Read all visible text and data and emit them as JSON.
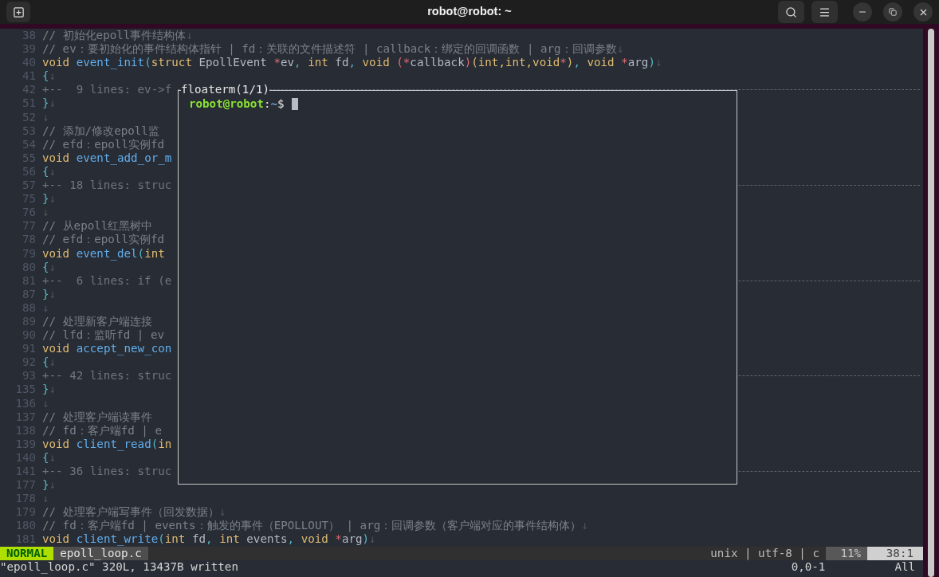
{
  "window": {
    "title": "robot@robot: ~"
  },
  "editor": {
    "lines": [
      {
        "number": "38",
        "kind": "code",
        "tokens": [
          {
            "kind": "comment",
            "text": "// 初始化epoll事件结构体"
          },
          {
            "kind": "eol",
            "text": "↓"
          }
        ]
      },
      {
        "number": "39",
        "kind": "code",
        "tokens": [
          {
            "kind": "comment",
            "text": "// ev：要初始化的事件结构体指针 | fd：关联的文件描述符 | callback：绑定的回调函数 | arg：回调参数"
          },
          {
            "kind": "eol",
            "text": "↓"
          }
        ]
      },
      {
        "number": "40",
        "kind": "code",
        "tokens": [
          {
            "kind": "keyword",
            "text": "void "
          },
          {
            "kind": "function",
            "text": "event_init"
          },
          {
            "kind": "punct",
            "text": "("
          },
          {
            "kind": "keyword",
            "text": "struct "
          },
          {
            "kind": "text",
            "text": "EpollEvent "
          },
          {
            "kind": "op",
            "text": "*"
          },
          {
            "kind": "text",
            "text": "ev"
          },
          {
            "kind": "punct",
            "text": ", "
          },
          {
            "kind": "keyword",
            "text": "int "
          },
          {
            "kind": "text",
            "text": "fd"
          },
          {
            "kind": "punct",
            "text": ", "
          },
          {
            "kind": "keyword",
            "text": "void "
          },
          {
            "kind": "op",
            "text": "(*"
          },
          {
            "kind": "text",
            "text": "callback"
          },
          {
            "kind": "op",
            "text": ")"
          },
          {
            "kind": "keyword",
            "text": "(int,int,void"
          },
          {
            "kind": "op",
            "text": "*"
          },
          {
            "kind": "keyword",
            "text": ")"
          },
          {
            "kind": "punct",
            "text": ", "
          },
          {
            "kind": "keyword",
            "text": "void "
          },
          {
            "kind": "op",
            "text": "*"
          },
          {
            "kind": "text",
            "text": "arg"
          },
          {
            "kind": "punct",
            "text": ")"
          },
          {
            "kind": "eol",
            "text": "↓"
          }
        ]
      },
      {
        "number": "41",
        "kind": "code",
        "tokens": [
          {
            "kind": "punct",
            "text": "{"
          },
          {
            "kind": "eol",
            "text": "↓"
          }
        ]
      },
      {
        "number": "42",
        "kind": "fold",
        "tokens": [
          {
            "kind": "fold",
            "text": "+--  9 lines: ev->f"
          }
        ]
      },
      {
        "number": "51",
        "kind": "code",
        "tokens": [
          {
            "kind": "punct",
            "text": "}"
          },
          {
            "kind": "eol",
            "text": "↓"
          }
        ]
      },
      {
        "number": "52",
        "kind": "code",
        "tokens": [
          {
            "kind": "eol",
            "text": "↓"
          }
        ]
      },
      {
        "number": "53",
        "kind": "code",
        "tokens": [
          {
            "kind": "comment",
            "text": "// 添加/修改epoll监"
          }
        ]
      },
      {
        "number": "54",
        "kind": "code",
        "tokens": [
          {
            "kind": "comment",
            "text": "// efd：epoll实例fd"
          }
        ]
      },
      {
        "number": "55",
        "kind": "code",
        "tokens": [
          {
            "kind": "keyword",
            "text": "void "
          },
          {
            "kind": "function",
            "text": "event_add_or_m"
          }
        ]
      },
      {
        "number": "56",
        "kind": "code",
        "tokens": [
          {
            "kind": "punct",
            "text": "{"
          },
          {
            "kind": "eol",
            "text": "↓"
          }
        ]
      },
      {
        "number": "57",
        "kind": "fold",
        "tokens": [
          {
            "kind": "fold",
            "text": "+-- 18 lines: struc"
          }
        ]
      },
      {
        "number": "75",
        "kind": "code",
        "tokens": [
          {
            "kind": "punct",
            "text": "}"
          },
          {
            "kind": "eol",
            "text": "↓"
          }
        ]
      },
      {
        "number": "76",
        "kind": "code",
        "tokens": [
          {
            "kind": "eol",
            "text": "↓"
          }
        ]
      },
      {
        "number": "77",
        "kind": "code",
        "tokens": [
          {
            "kind": "comment",
            "text": "// 从epoll红黑树中"
          }
        ]
      },
      {
        "number": "78",
        "kind": "code",
        "tokens": [
          {
            "kind": "comment",
            "text": "// efd：epoll实例fd"
          }
        ]
      },
      {
        "number": "79",
        "kind": "code",
        "tokens": [
          {
            "kind": "keyword",
            "text": "void "
          },
          {
            "kind": "function",
            "text": "event_del"
          },
          {
            "kind": "punct",
            "text": "("
          },
          {
            "kind": "keyword",
            "text": "int"
          }
        ]
      },
      {
        "number": "80",
        "kind": "code",
        "tokens": [
          {
            "kind": "punct",
            "text": "{"
          },
          {
            "kind": "eol",
            "text": "↓"
          }
        ]
      },
      {
        "number": "81",
        "kind": "fold",
        "tokens": [
          {
            "kind": "fold",
            "text": "+--  6 lines: if (e"
          }
        ]
      },
      {
        "number": "87",
        "kind": "code",
        "tokens": [
          {
            "kind": "punct",
            "text": "}"
          },
          {
            "kind": "eol",
            "text": "↓"
          }
        ]
      },
      {
        "number": "88",
        "kind": "code",
        "tokens": [
          {
            "kind": "eol",
            "text": "↓"
          }
        ]
      },
      {
        "number": "89",
        "kind": "code",
        "tokens": [
          {
            "kind": "comment",
            "text": "// 处理新客户端连接"
          }
        ]
      },
      {
        "number": "90",
        "kind": "code",
        "tokens": [
          {
            "kind": "comment",
            "text": "// lfd：监听fd | ev"
          }
        ]
      },
      {
        "number": "91",
        "kind": "code",
        "tokens": [
          {
            "kind": "keyword",
            "text": "void "
          },
          {
            "kind": "function",
            "text": "accept_new_con"
          }
        ]
      },
      {
        "number": "92",
        "kind": "code",
        "tokens": [
          {
            "kind": "punct",
            "text": "{"
          },
          {
            "kind": "eol",
            "text": "↓"
          }
        ]
      },
      {
        "number": "93",
        "kind": "fold",
        "tokens": [
          {
            "kind": "fold",
            "text": "+-- 42 lines: struc"
          }
        ]
      },
      {
        "number": "135",
        "kind": "code",
        "tokens": [
          {
            "kind": "punct",
            "text": "}"
          },
          {
            "kind": "eol",
            "text": "↓"
          }
        ]
      },
      {
        "number": "136",
        "kind": "code",
        "tokens": [
          {
            "kind": "eol",
            "text": "↓"
          }
        ]
      },
      {
        "number": "137",
        "kind": "code",
        "tokens": [
          {
            "kind": "comment",
            "text": "// 处理客户端读事件"
          }
        ]
      },
      {
        "number": "138",
        "kind": "code",
        "tokens": [
          {
            "kind": "comment",
            "text": "// fd：客户端fd | e"
          }
        ]
      },
      {
        "number": "139",
        "kind": "code",
        "tokens": [
          {
            "kind": "keyword",
            "text": "void "
          },
          {
            "kind": "function",
            "text": "client_read"
          },
          {
            "kind": "punct",
            "text": "("
          },
          {
            "kind": "keyword",
            "text": "in"
          }
        ]
      },
      {
        "number": "140",
        "kind": "code",
        "tokens": [
          {
            "kind": "punct",
            "text": "{"
          },
          {
            "kind": "eol",
            "text": "↓"
          }
        ]
      },
      {
        "number": "141",
        "kind": "fold",
        "tokens": [
          {
            "kind": "fold",
            "text": "+-- 36 lines: struc"
          }
        ]
      },
      {
        "number": "177",
        "kind": "code",
        "tokens": [
          {
            "kind": "punct",
            "text": "}"
          },
          {
            "kind": "eol",
            "text": "↓"
          }
        ]
      },
      {
        "number": "178",
        "kind": "code",
        "tokens": [
          {
            "kind": "eol",
            "text": "↓"
          }
        ]
      },
      {
        "number": "179",
        "kind": "code",
        "tokens": [
          {
            "kind": "comment",
            "text": "// 处理客户端写事件（回发数据）"
          },
          {
            "kind": "eol",
            "text": "↓"
          }
        ]
      },
      {
        "number": "180",
        "kind": "code",
        "tokens": [
          {
            "kind": "comment",
            "text": "// fd：客户端fd | events：触发的事件（EPOLLOUT） | arg：回调参数（客户端对应的事件结构体）"
          },
          {
            "kind": "eol",
            "text": "↓"
          }
        ]
      },
      {
        "number": "181",
        "kind": "code",
        "tokens": [
          {
            "kind": "keyword",
            "text": "void "
          },
          {
            "kind": "function",
            "text": "client_write"
          },
          {
            "kind": "punct",
            "text": "("
          },
          {
            "kind": "keyword",
            "text": "int "
          },
          {
            "kind": "text",
            "text": "fd"
          },
          {
            "kind": "punct",
            "text": ", "
          },
          {
            "kind": "keyword",
            "text": "int "
          },
          {
            "kind": "text",
            "text": "events"
          },
          {
            "kind": "punct",
            "text": ", "
          },
          {
            "kind": "keyword",
            "text": "void "
          },
          {
            "kind": "op",
            "text": "*"
          },
          {
            "kind": "text",
            "text": "arg"
          },
          {
            "kind": "punct",
            "text": ")"
          },
          {
            "kind": "eol",
            "text": "↓"
          }
        ]
      }
    ]
  },
  "floaterm": {
    "title": "floaterm(1/1)",
    "prompt": [
      {
        "kind": "user",
        "text": "robot@robot"
      },
      {
        "kind": "sep",
        "text": ":"
      },
      {
        "kind": "path",
        "text": "~"
      },
      {
        "kind": "sep",
        "text": "$"
      }
    ]
  },
  "statusline": {
    "mode": "NORMAL",
    "file": "epoll_loop.c",
    "info": "unix | utf-8 | c",
    "percent": "11%",
    "position": "38:1"
  },
  "cmdline": {
    "message": "\"epoll_loop.c\" 320L, 13437B written",
    "ruler": "0,0-1",
    "scroll": "All"
  }
}
